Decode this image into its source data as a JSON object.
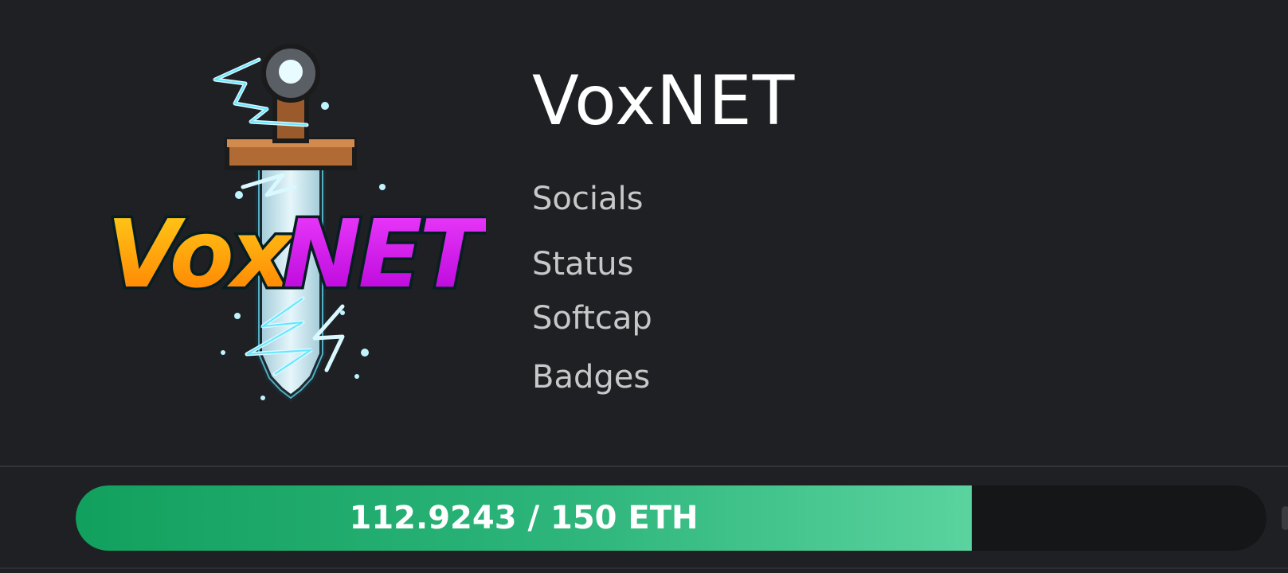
{
  "project": {
    "logo_text_left": "Vox",
    "logo_text_right": "NET",
    "title": "VoxNET",
    "labels": [
      "Socials",
      "Status",
      "Softcap",
      "Badges"
    ]
  },
  "progress": {
    "raised": 112.9243,
    "cap": 150,
    "fraction": 0.75283,
    "text": "112.9243 / 150 ETH"
  },
  "colors": {
    "background": "#1f2024",
    "progress_fill": "#2db57b",
    "progress_track": "#151618",
    "logo_yellow": "#ffc400",
    "logo_magenta": "#d51fe6"
  }
}
